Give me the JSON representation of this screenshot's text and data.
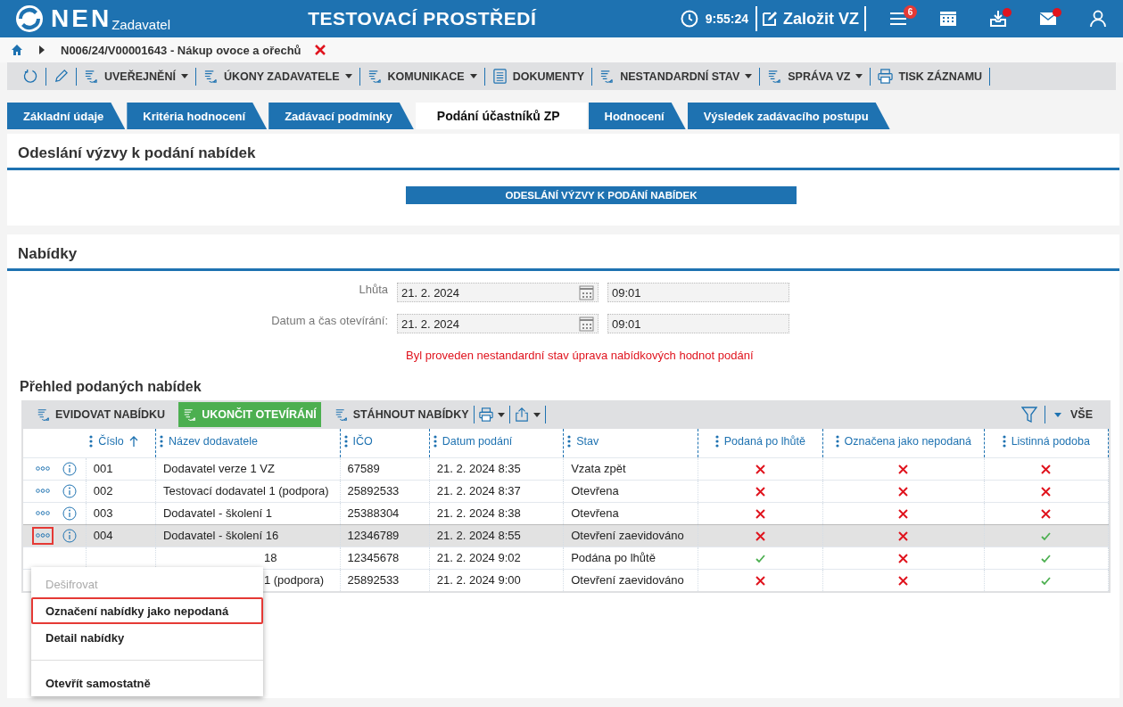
{
  "header": {
    "logo": "NEN",
    "logo_sub": "Zadavatel",
    "env_title": "TESTOVACÍ PROSTŘEDÍ",
    "time": "9:55:24",
    "create_button": "Založit VZ",
    "icons": [
      {
        "kind": "menu",
        "badge": "6",
        "dot": false
      },
      {
        "kind": "calendar",
        "dot": false
      },
      {
        "kind": "inbox",
        "dot": true
      },
      {
        "kind": "mail",
        "dot": true
      },
      {
        "kind": "user",
        "dot": false
      }
    ]
  },
  "breadcrumb": {
    "path": "N006/24/V00001643 - Nákup ovoce a ořechů",
    "closable": true
  },
  "toolbar": [
    {
      "kind": "refresh"
    },
    {
      "kind": "edit"
    },
    {
      "kind": "action",
      "label": "UVEŘEJNĚNÍ",
      "dropdown": true
    },
    {
      "kind": "action",
      "label": "ÚKONY ZADAVATELE",
      "dropdown": true
    },
    {
      "kind": "action",
      "label": "KOMUNIKACE",
      "dropdown": true
    },
    {
      "kind": "document",
      "label": "DOKUMENTY",
      "dropdown": false
    },
    {
      "kind": "action",
      "label": "NESTANDARDNÍ STAV",
      "dropdown": true
    },
    {
      "kind": "action",
      "label": "SPRÁVA VZ",
      "dropdown": true
    },
    {
      "kind": "print",
      "label": "TISK ZÁZNAMU",
      "dropdown": false
    }
  ],
  "tabs": [
    {
      "label": "Základní údaje",
      "selected": false
    },
    {
      "label": "Kritéria hodnocení",
      "selected": false
    },
    {
      "label": "Zadávací podmínky",
      "selected": false
    },
    {
      "label": "Podání účastníků ZP",
      "selected": true
    },
    {
      "label": "Hodnocení",
      "selected": false
    },
    {
      "label": "Výsledek zadávacího postupu",
      "selected": false
    }
  ],
  "invitation": {
    "title": "Odeslání výzvy k podání nabídek",
    "button": "ODESLÁNÍ VÝZVY K PODÁNÍ NABÍDEK"
  },
  "offers": {
    "title": "Nabídky",
    "fields": [
      {
        "label": "Lhůta",
        "date": "21. 2. 2024",
        "time": "09:01"
      },
      {
        "label": "Datum a čas otevírání:",
        "date": "21. 2. 2024",
        "time": "09:01"
      }
    ],
    "warning": "Byl proveden nestandardní stav úprava nabídkových hodnot podání",
    "overview_title": "Přehled podaných nabídek",
    "grid_toolbar": [
      {
        "kind": "action",
        "label": "EVIDOVAT NABÍDKU",
        "primary": false
      },
      {
        "kind": "action",
        "label": "UKONČIT OTEVÍRÁNÍ",
        "primary": true
      },
      {
        "kind": "action",
        "label": "STÁHNOUT NABÍDKY",
        "primary": false
      },
      {
        "kind": "print"
      },
      {
        "kind": "export"
      }
    ],
    "filter_label": "VŠE",
    "columns": [
      {
        "label": "Číslo",
        "sorted": true,
        "kind": "text"
      },
      {
        "label": "Název dodavatele",
        "sorted": false,
        "kind": "text"
      },
      {
        "label": "IČO",
        "sorted": false,
        "kind": "text"
      },
      {
        "label": "Datum podání",
        "sorted": false,
        "kind": "text"
      },
      {
        "label": "Stav",
        "sorted": false,
        "kind": "text"
      },
      {
        "label": "Podaná po lhůtě",
        "sorted": false,
        "kind": "flag"
      },
      {
        "label": "Označena jako nepodaná",
        "sorted": false,
        "kind": "flag"
      },
      {
        "label": "Listinná podoba",
        "sorted": false,
        "kind": "flag"
      }
    ],
    "rows": [
      {
        "number": "001",
        "name": "Dodavatel verze 1 VZ",
        "ico": "67589",
        "date": "21. 2. 2024 8:35",
        "status": "Vzata zpět",
        "late": false,
        "not_submitted": false,
        "paper": false,
        "selected": false,
        "menu_open": false,
        "covered": false
      },
      {
        "number": "002",
        "name": "Testovací dodavatel 1 (podpora)",
        "ico": "25892533",
        "date": "21. 2. 2024 8:37",
        "status": "Otevřena",
        "late": false,
        "not_submitted": false,
        "paper": false,
        "selected": false,
        "menu_open": false,
        "covered": false
      },
      {
        "number": "003",
        "name": "Dodavatel - školení 1",
        "ico": "25388304",
        "date": "21. 2. 2024 8:38",
        "status": "Otevřena",
        "late": false,
        "not_submitted": false,
        "paper": false,
        "selected": false,
        "menu_open": false,
        "covered": false
      },
      {
        "number": "004",
        "name": "Dodavatel - školení 16",
        "ico": "12346789",
        "date": "21. 2. 2024 8:55",
        "status": "Otevření zaevidováno",
        "late": false,
        "not_submitted": false,
        "paper": true,
        "selected": true,
        "menu_open": true,
        "covered": false
      },
      {
        "name": "18",
        "ico": "12345678",
        "date": "21. 2. 2024 9:02",
        "status": "Podána po lhůtě",
        "late": true,
        "not_submitted": false,
        "paper": true,
        "selected": false,
        "covered": true
      },
      {
        "name": "1 (podpora)",
        "ico": "25892533",
        "date": "21. 2. 2024 9:00",
        "status": "Otevření zaevidováno",
        "late": false,
        "not_submitted": false,
        "paper": true,
        "selected": false,
        "covered": true
      }
    ],
    "context_menu": [
      {
        "kind": "item",
        "label": "Dešifrovat",
        "disabled": true,
        "selected": false
      },
      {
        "kind": "item",
        "label": "Označení nabídky jako nepodaná",
        "disabled": false,
        "selected": true
      },
      {
        "kind": "item",
        "label": "Detail nabídky",
        "disabled": false,
        "selected": false
      },
      {
        "kind": "divider"
      },
      {
        "kind": "item",
        "label": "Otevřít samostatně",
        "disabled": false,
        "selected": false
      }
    ]
  }
}
